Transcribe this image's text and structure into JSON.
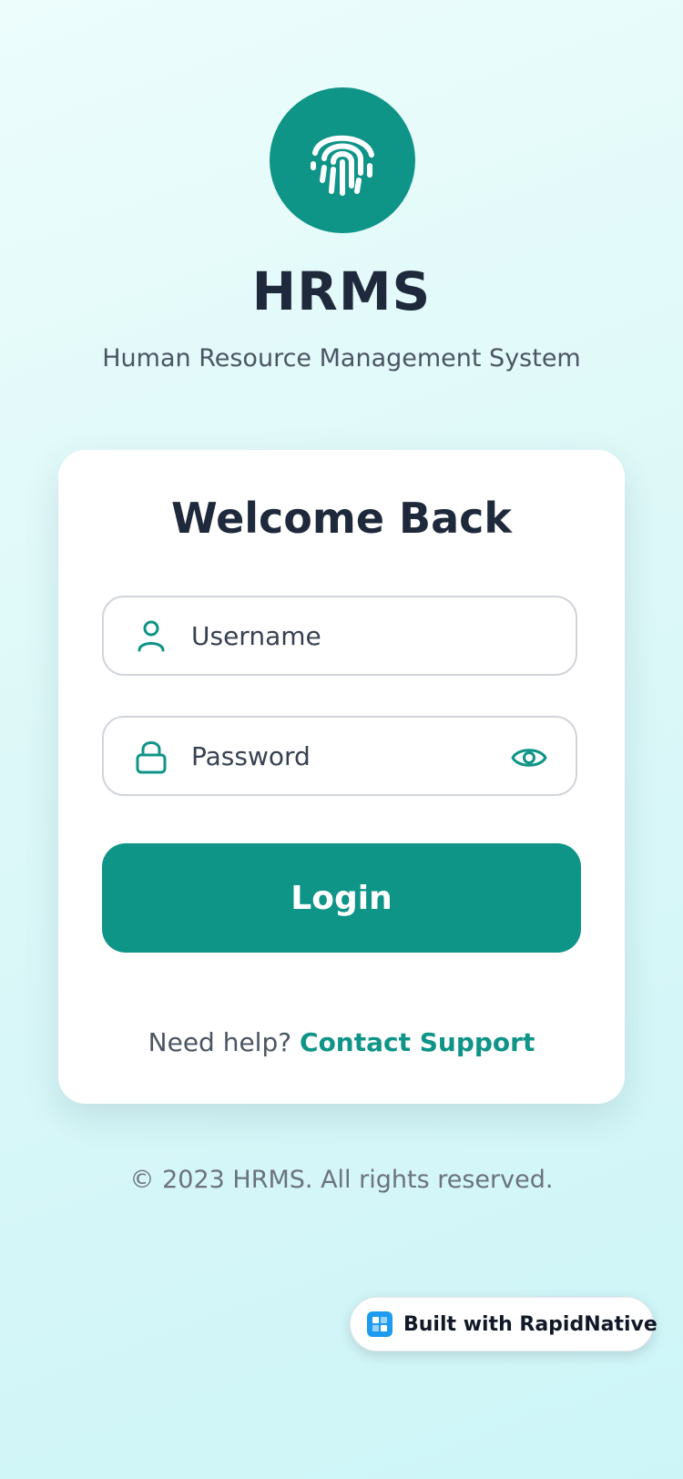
{
  "app": {
    "title": "HRMS",
    "subtitle": "Human Resource Management System",
    "logo_icon": "fingerprint-icon"
  },
  "login_card": {
    "heading": "Welcome Back",
    "username": {
      "placeholder": "Username",
      "value": "",
      "icon": "user-icon"
    },
    "password": {
      "placeholder": "Password",
      "value": "",
      "icon": "lock-icon",
      "toggle_icon": "eye-icon"
    },
    "login_label": "Login",
    "help_text": "Need help?",
    "help_link": "Contact Support"
  },
  "footer": {
    "copyright": "© 2023 HRMS. All rights reserved."
  },
  "badge": {
    "label": "Built with RapidNative",
    "icon": "rapidnative-logo-icon"
  },
  "colors": {
    "accent": "#0f9488",
    "heading": "#1e293b",
    "muted": "#4b5563",
    "background_start": "#ecfdfc",
    "background_end": "#cdf5f8"
  }
}
